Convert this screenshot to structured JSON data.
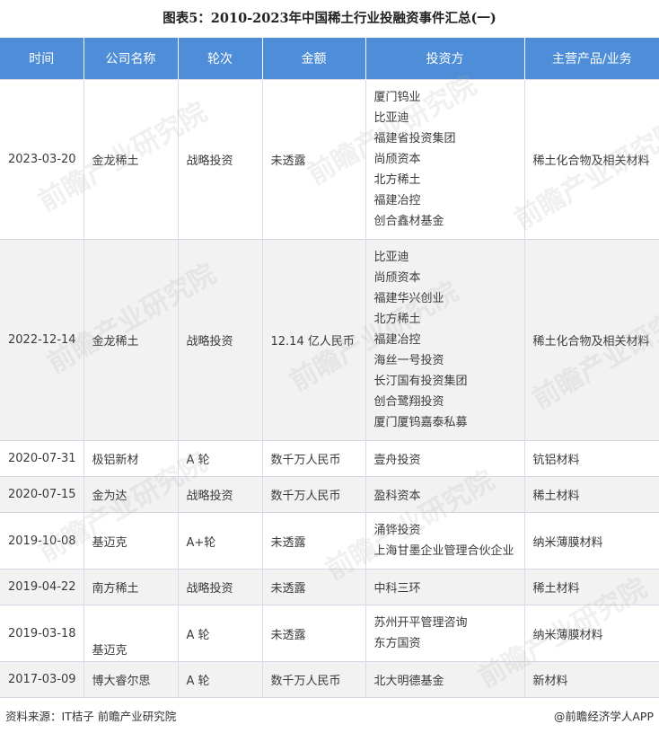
{
  "title": "图表5：2010-2023年中国稀土行业投融资事件汇总(一)",
  "headers": [
    "时间",
    "公司名称",
    "轮次",
    "金额",
    "投资方",
    "主营产品/业务"
  ],
  "rows": [
    {
      "date": "2023-03-20",
      "company": "金龙稀土",
      "round": "战略投资",
      "amount": "未透露",
      "investors": [
        "厦门钨业",
        "比亚迪",
        "福建省投资集团",
        "尚颀资本",
        "北方稀土",
        "福建冶控",
        "创合鑫材基金"
      ],
      "business": "稀土化合物及相关材料"
    },
    {
      "date": "2022-12-14",
      "company": "金龙稀土",
      "round": "战略投资",
      "amount": "12.14 亿人民币",
      "investors": [
        "比亚迪",
        "尚颀资本",
        "福建华兴创业",
        "北方稀土",
        "福建冶控",
        "海丝一号投资",
        "长汀国有投资集团",
        "创合鹭翔投资",
        "厦门厦钨嘉泰私募"
      ],
      "business": "稀土化合物及相关材料"
    },
    {
      "date": "2020-07-31",
      "company": "极铝新材",
      "round": "A 轮",
      "amount": "数千万人民币",
      "investors": [
        "壹舟投资"
      ],
      "business": "钪铝材料"
    },
    {
      "date": "2020-07-15",
      "company": "金为达",
      "round": "战略投资",
      "amount": "数千万人民币",
      "investors": [
        "盈科资本"
      ],
      "business": "稀土材料"
    },
    {
      "date": "2019-10-08",
      "company": "基迈克",
      "round": "A+轮",
      "amount": "未透露",
      "investors": [
        "涌铧投资",
        "上海甘墨企业管理合伙企业"
      ],
      "business": "纳米薄膜材料"
    },
    {
      "date": "2019-04-22",
      "company": "南方稀土",
      "round": "战略投资",
      "amount": "未透露",
      "investors": [
        "中科三环"
      ],
      "business": "稀土材料"
    },
    {
      "date": "2019-03-18",
      "company": "基迈克",
      "round": "A 轮",
      "amount": "未透露",
      "investors": [
        "苏州开平管理咨询",
        "东方国资"
      ],
      "business": "纳米薄膜材料"
    },
    {
      "date": "2017-03-09",
      "company": "博大睿尔思",
      "round": "A 轮",
      "amount": "数千万人民币",
      "investors": [
        "北大明德基金"
      ],
      "business": "新材料"
    }
  ],
  "footer": {
    "source": "资料来源：IT桔子 前瞻产业研究院",
    "brand": "@前瞻经济学人APP"
  },
  "watermark": "前瞻产业研究院",
  "colors": {
    "header_bg": "#4e8ed9",
    "alt_row_bg": "#f2f2f2",
    "text": "#333333"
  }
}
